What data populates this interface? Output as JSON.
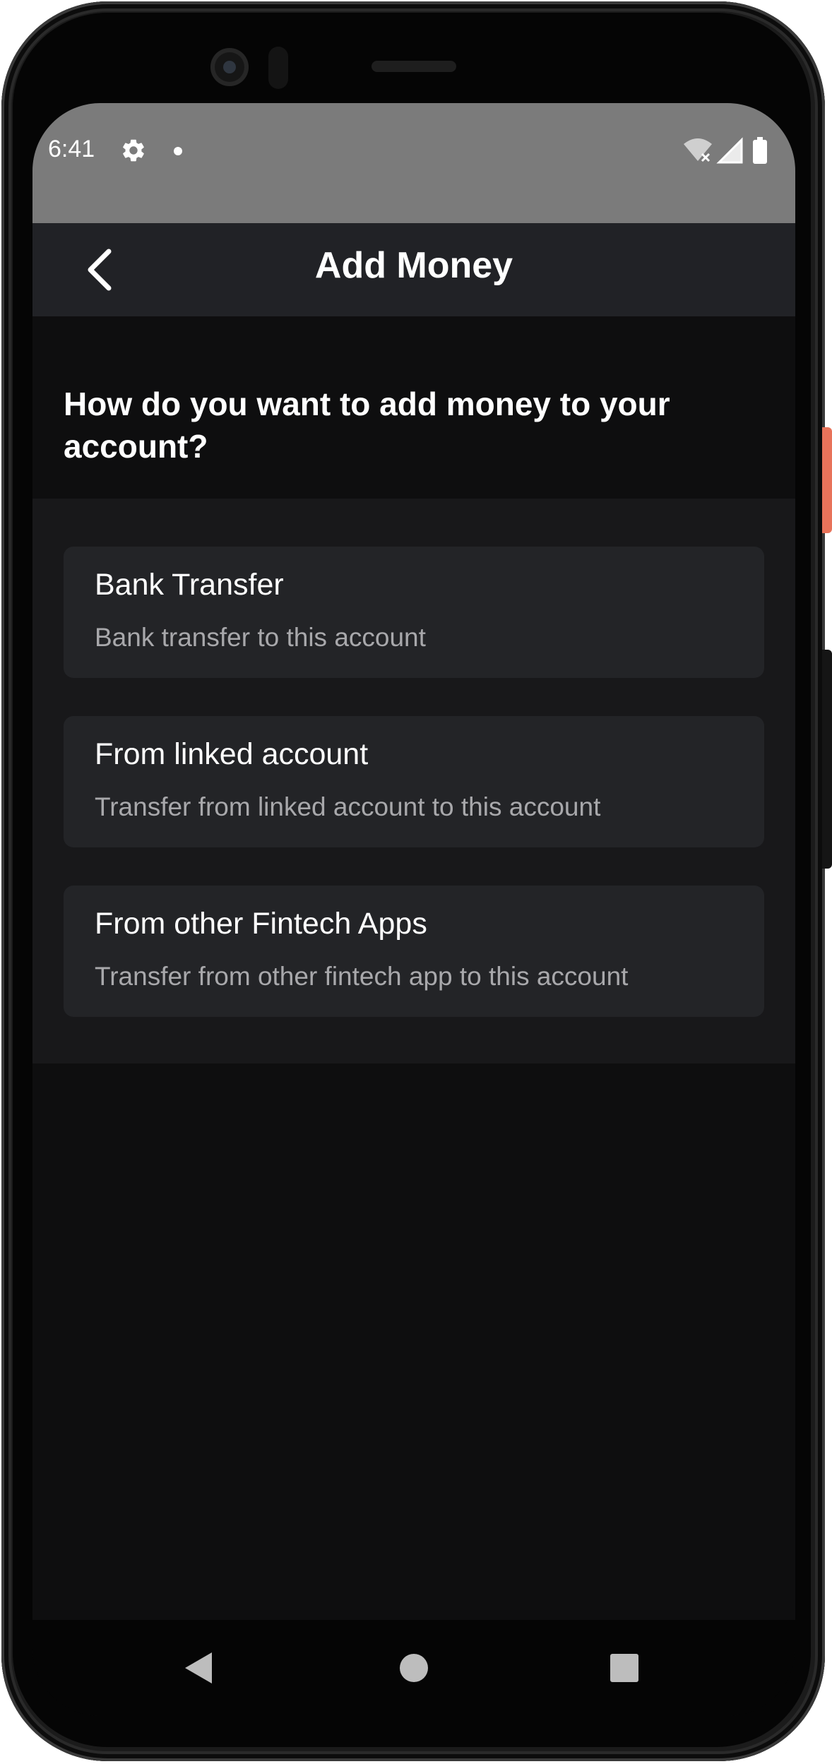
{
  "status_bar": {
    "time": "6:41",
    "icons": [
      "gear-icon",
      "notification-dot-icon",
      "wifi-off-icon",
      "cell-signal-icon",
      "battery-icon"
    ]
  },
  "app_bar": {
    "back_icon": "chevron-left-icon",
    "title": "Add Money"
  },
  "main": {
    "question": "How do you want to add money to your account?",
    "options": [
      {
        "title": "Bank Transfer",
        "subtitle": "Bank transfer to this account"
      },
      {
        "title": "From linked account",
        "subtitle": "Transfer from linked account to this account"
      },
      {
        "title": "From other Fintech Apps",
        "subtitle": "Transfer from other fintech app to this account"
      }
    ]
  },
  "nav_bar": {
    "icons": [
      "back-triangle-icon",
      "home-circle-icon",
      "recents-square-icon"
    ]
  },
  "colors": {
    "background": "#0e0e0f",
    "app_bar": "#212226",
    "card": "#232427",
    "status_bar": "#7b7b7b",
    "text_primary": "#ffffff",
    "text_secondary": "#a8a8ab"
  }
}
